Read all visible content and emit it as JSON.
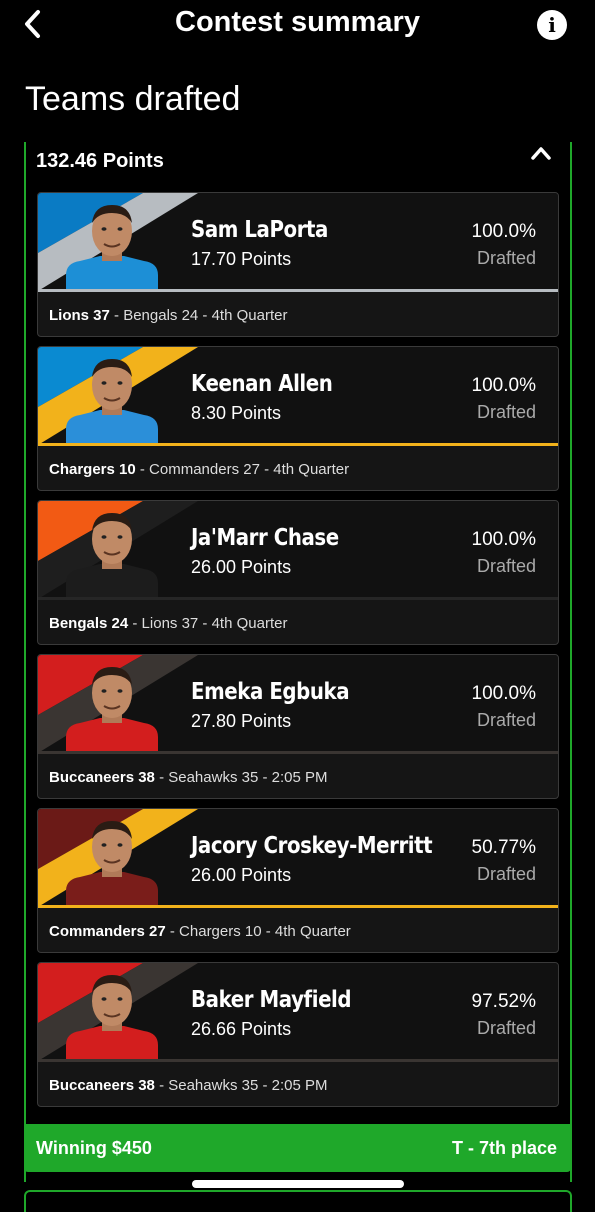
{
  "header": {
    "title": "Contest summary"
  },
  "page_title": "Teams drafted",
  "total_points": "132.46 Points",
  "players": [
    {
      "name": "Sam LaPorta",
      "points": "17.70 Points",
      "pct": "100.0%",
      "drafted": "Drafted",
      "game_team": "Lions 37",
      "game_rest": " - Bengals 24 - 4th Quarter",
      "colors": {
        "stripe1": "#0a7bc4",
        "stripe2": "#b7bcc1",
        "jersey": "#1d8fd6",
        "line": "#b7bcc1"
      }
    },
    {
      "name": "Keenan Allen",
      "points": "8.30 Points",
      "pct": "100.0%",
      "drafted": "Drafted",
      "game_team": "Chargers 10",
      "game_rest": " - Commanders 27 - 4th Quarter",
      "colors": {
        "stripe1": "#0a8ad1",
        "stripe2": "#f2b21b",
        "jersey": "#2b8fd9",
        "line": "#f2b21b"
      }
    },
    {
      "name": "Ja'Marr Chase",
      "points": "26.00 Points",
      "pct": "100.0%",
      "drafted": "Drafted",
      "game_team": "Bengals 24",
      "game_rest": " - Lions 37 - 4th Quarter",
      "colors": {
        "stripe1": "#f25a14",
        "stripe2": "#1e1e1e",
        "jersey": "#1c1c1c",
        "line": "#262626"
      }
    },
    {
      "name": "Emeka Egbuka",
      "points": "27.80 Points",
      "pct": "100.0%",
      "drafted": "Drafted",
      "game_team": "Buccaneers 38",
      "game_rest": " - Seahawks 35 - 2:05 PM",
      "colors": {
        "stripe1": "#d31e1e",
        "stripe2": "#3a3532",
        "jersey": "#d31e1e",
        "line": "#3a3532"
      }
    },
    {
      "name": "Jacory Croskey-Merritt",
      "points": "26.00 Points",
      "pct": "50.77%",
      "drafted": "Drafted",
      "game_team": "Commanders 27",
      "game_rest": " - Chargers 10 - 4th Quarter",
      "colors": {
        "stripe1": "#6b1a17",
        "stripe2": "#f2b21b",
        "jersey": "#7a1d1a",
        "line": "#f2b21b"
      }
    },
    {
      "name": "Baker Mayfield",
      "points": "26.66 Points",
      "pct": "97.52%",
      "drafted": "Drafted",
      "game_team": "Buccaneers 38",
      "game_rest": " - Seahawks 35 - 2:05 PM",
      "colors": {
        "stripe1": "#d31e1e",
        "stripe2": "#3a3532",
        "jersey": "#d31e1e",
        "line": "#3a3532"
      }
    }
  ],
  "footer": {
    "winning": "Winning $450",
    "place": "T - 7th place"
  },
  "icons": {
    "back": "chevron-left-icon",
    "info": "info-icon",
    "collapse": "chevron-up-icon"
  },
  "colors": {
    "accent": "#1fa82a",
    "background": "#000000"
  }
}
